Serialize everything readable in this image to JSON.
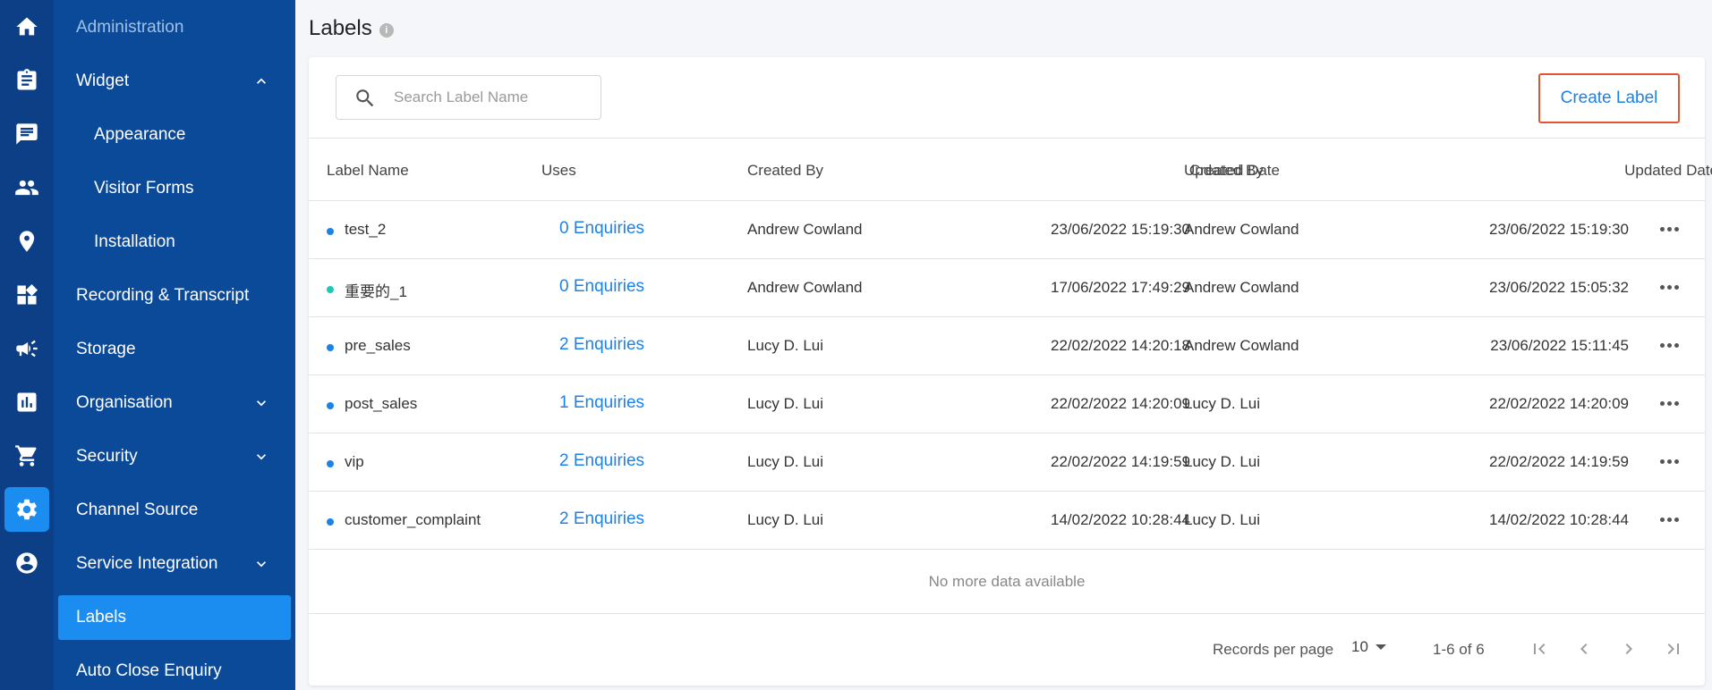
{
  "rail": {
    "items": [
      {
        "icon": "home-icon"
      },
      {
        "icon": "clipboard-icon"
      },
      {
        "icon": "chat-icon"
      },
      {
        "icon": "people-icon"
      },
      {
        "icon": "location-pin-icon"
      },
      {
        "icon": "widgets-icon"
      },
      {
        "icon": "megaphone-icon"
      },
      {
        "icon": "bar-chart-icon"
      },
      {
        "icon": "cart-icon"
      },
      {
        "icon": "gear-icon",
        "active": true
      },
      {
        "icon": "account-icon"
      }
    ]
  },
  "sidebar": {
    "header": "Administration",
    "items": [
      {
        "label": "Widget",
        "chevron": "up"
      },
      {
        "label": "Appearance",
        "sub": true
      },
      {
        "label": "Visitor Forms",
        "sub": true
      },
      {
        "label": "Installation",
        "sub": true
      },
      {
        "label": "Recording & Transcript"
      },
      {
        "label": "Storage"
      },
      {
        "label": "Organisation",
        "chevron": "down"
      },
      {
        "label": "Security",
        "chevron": "down"
      },
      {
        "label": "Channel Source"
      },
      {
        "label": "Service Integration",
        "chevron": "down"
      },
      {
        "label": "Labels",
        "active": true
      },
      {
        "label": "Auto Close Enquiry"
      }
    ]
  },
  "page": {
    "title": "Labels",
    "info_glyph": "i"
  },
  "search": {
    "placeholder": "Search Label Name",
    "value": ""
  },
  "toolbar": {
    "create_label": "Create Label"
  },
  "table": {
    "columns": [
      "Label Name",
      "Uses",
      "Created By",
      "Created Date",
      "Updated By",
      "Updated Date"
    ],
    "rows": [
      {
        "label": "test_2",
        "dot_color": "#1b82e6",
        "uses": "0 Enquiries",
        "created_by": "Andrew Cowland",
        "created_date": "23/06/2022  15:19:30",
        "updated_by": "Andrew Cowland",
        "updated_date": "23/06/2022  15:19:30"
      },
      {
        "label": "重要的_1",
        "dot_color": "#1fc7b6",
        "uses": "0 Enquiries",
        "created_by": "Andrew Cowland",
        "created_date": "17/06/2022  17:49:29",
        "updated_by": "Andrew Cowland",
        "updated_date": "23/06/2022  15:05:32"
      },
      {
        "label": "pre_sales",
        "dot_color": "#1b82e6",
        "uses": "2 Enquiries",
        "created_by": "Lucy D. Lui",
        "created_date": "22/02/2022  14:20:18",
        "updated_by": "Andrew Cowland",
        "updated_date": "23/06/2022  15:11:45"
      },
      {
        "label": "post_sales",
        "dot_color": "#1b82e6",
        "uses": "1 Enquiries",
        "created_by": "Lucy D. Lui",
        "created_date": "22/02/2022  14:20:09",
        "updated_by": "Lucy D. Lui",
        "updated_date": "22/02/2022  14:20:09"
      },
      {
        "label": "vip",
        "dot_color": "#1b82e6",
        "uses": "2 Enquiries",
        "created_by": "Lucy D. Lui",
        "created_date": "22/02/2022  14:19:59",
        "updated_by": "Lucy D. Lui",
        "updated_date": "22/02/2022  14:19:59"
      },
      {
        "label": "customer_complaint",
        "dot_color": "#1b82e6",
        "uses": "2 Enquiries",
        "created_by": "Lucy D. Lui",
        "created_date": "14/02/2022  10:28:44",
        "updated_by": "Lucy D. Lui",
        "updated_date": "14/02/2022  10:28:44"
      }
    ],
    "no_more": "No more data available"
  },
  "pagination": {
    "records_per_page_label": "Records per page",
    "per_page": "10",
    "range": "1-6 of 6"
  },
  "colors": {
    "accent": "#1b82e6",
    "rail_bg": "#0d3f87",
    "sidebar_bg": "#0b4a99",
    "active_bg": "#1b8cf0",
    "highlight_border": "#e0562e"
  }
}
